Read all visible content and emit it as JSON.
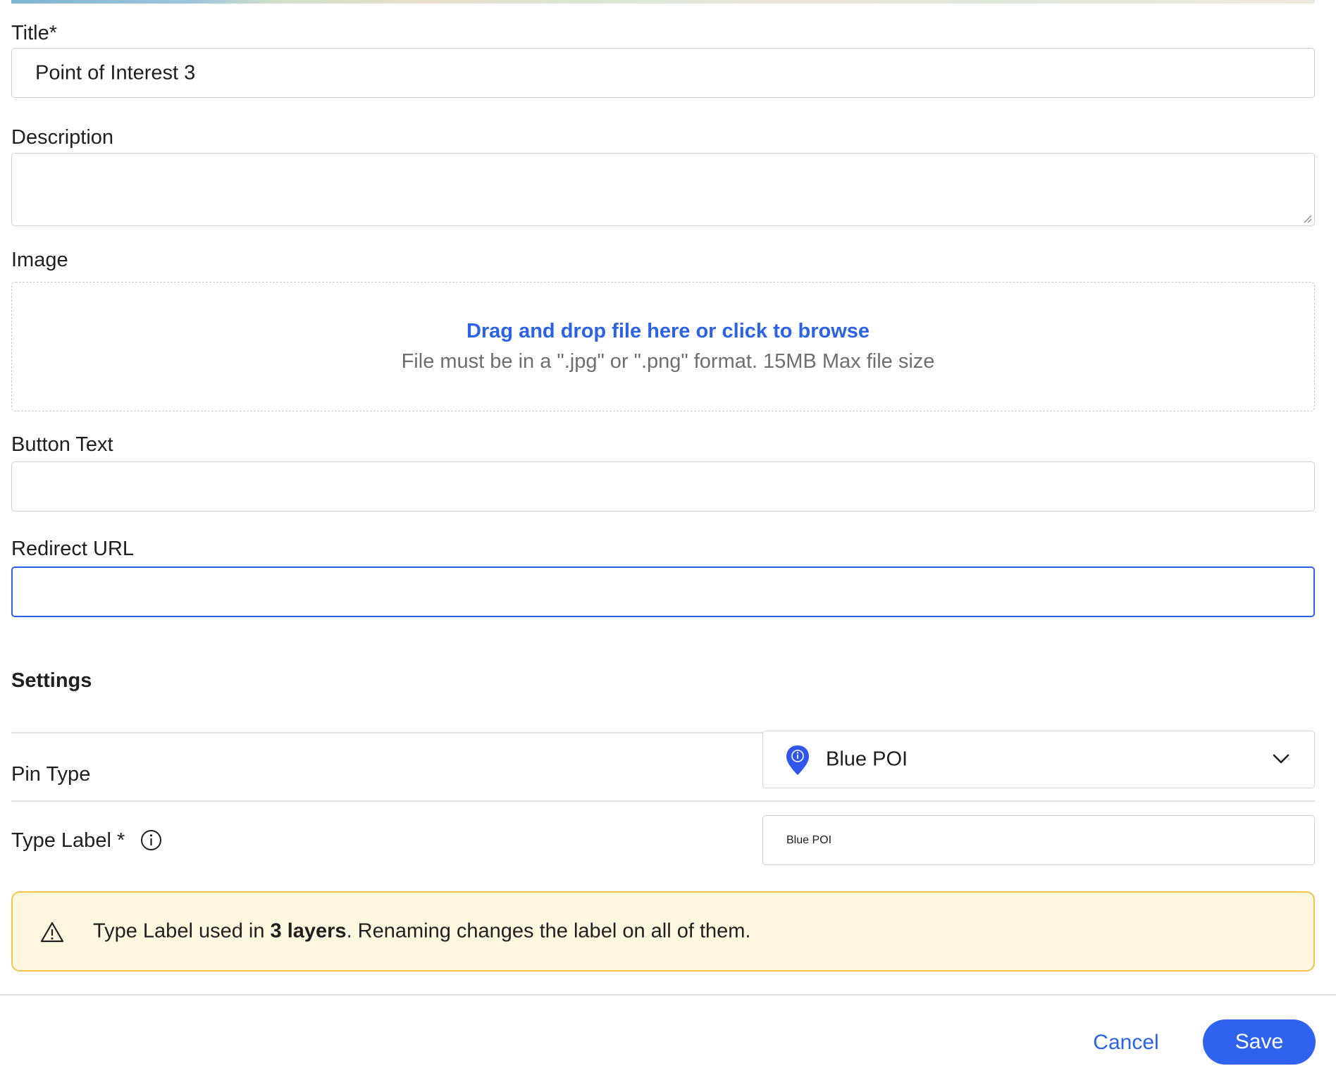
{
  "form": {
    "title_label": "Title*",
    "title_value": "Point of Interest 3",
    "description_label": "Description",
    "description_value": "",
    "image_label": "Image",
    "image_dropzone": {
      "link_text": "Drag and drop file here or click to browse",
      "hint_text": "File must be in a \".jpg\" or \".png\" format. 15MB Max file size"
    },
    "button_text_label": "Button Text",
    "button_text_value": "",
    "redirect_url_label": "Redirect URL",
    "redirect_url_value": ""
  },
  "settings": {
    "section_title": "Settings",
    "pin_type_label": "Pin Type",
    "pin_type_value": "Blue POI",
    "pin_icon": "blue-map-pin-icon",
    "type_label_label": "Type Label *",
    "type_label_value": "Blue POI",
    "info_icon": "info-icon"
  },
  "warning": {
    "icon": "warning-triangle-icon",
    "text_before": "Type Label used in ",
    "text_bold": "3 layers",
    "text_after": ". Renaming changes the label on all of them."
  },
  "footer": {
    "cancel_label": "Cancel",
    "save_label": "Save"
  },
  "colors": {
    "accent": "#2f62ee",
    "link": "#2b62e6",
    "focus_border": "#2f5ee8",
    "warning_bg": "#fef7e0",
    "warning_border": "#f2c44a"
  }
}
